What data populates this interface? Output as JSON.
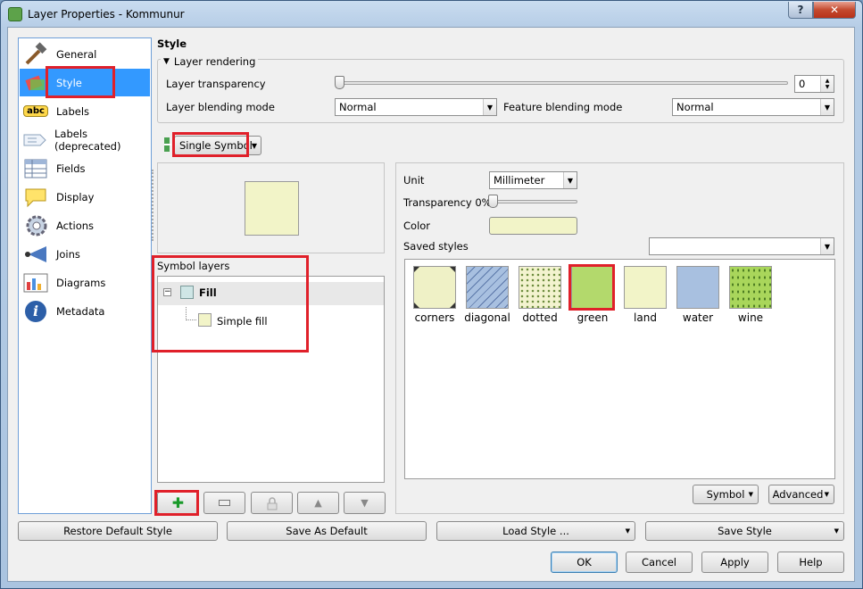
{
  "window": {
    "title": "Layer Properties - Kommunur",
    "help_glyph": "?",
    "close_glyph": "✕"
  },
  "nav": {
    "items": [
      {
        "label": "General",
        "icon": "hammer-icon"
      },
      {
        "label": "Style",
        "icon": "style-icon"
      },
      {
        "label": "Labels",
        "icon": "abc-labels-icon"
      },
      {
        "label": "Labels (deprecated)",
        "icon": "label-tag-icon"
      },
      {
        "label": "Fields",
        "icon": "table-icon"
      },
      {
        "label": "Display",
        "icon": "speech-bubble-icon"
      },
      {
        "label": "Actions",
        "icon": "gear-icon"
      },
      {
        "label": "Joins",
        "icon": "join-icon"
      },
      {
        "label": "Diagrams",
        "icon": "chart-icon"
      },
      {
        "label": "Metadata",
        "icon": "info-icon"
      }
    ],
    "abc_text": "abc",
    "info_glyph": "i"
  },
  "style": {
    "heading": "Style",
    "layer_rendering": {
      "label": "Layer rendering",
      "transparency_label": "Layer transparency",
      "transparency_value": "0",
      "transparency_level": 0,
      "blending_label": "Layer blending mode",
      "blending_value": "Normal",
      "feature_blending_label": "Feature blending mode",
      "feature_blending_value": "Normal"
    },
    "renderer": "Single Symbol",
    "symbol_layers_label": "Symbol layers",
    "tree": {
      "fill": "Fill",
      "simple_fill": "Simple fill"
    },
    "unit_label": "Unit",
    "unit_value": "Millimeter",
    "transparency_label": "Transparency 0%",
    "transparency_level": 0,
    "color_label": "Color",
    "color_value": "#f2f4c8",
    "saved_styles_label": "Saved styles",
    "saved_styles_value": "",
    "swatches": [
      {
        "name": "corners",
        "color": "#eff1c6"
      },
      {
        "name": "diagonal",
        "color": "#a8c0e0"
      },
      {
        "name": "dotted",
        "color": "#f3f3cf"
      },
      {
        "name": "green",
        "color": "#b3d96c"
      },
      {
        "name": "land",
        "color": "#f2f4c8"
      },
      {
        "name": "water",
        "color": "#a8c0e0"
      },
      {
        "name": "wine",
        "color": "#a9d65b"
      }
    ],
    "symbol_btn": "Symbol",
    "advanced_btn": "Advanced"
  },
  "bottom": {
    "restore": "Restore Default Style",
    "save_default": "Save As Default",
    "load": "Load Style ...",
    "save_style": "Save Style"
  },
  "dialog": {
    "ok": "OK",
    "cancel": "Cancel",
    "apply": "Apply",
    "help": "Help"
  },
  "colors": {
    "highlight": "#e0202a",
    "selection": "#3399ff"
  }
}
